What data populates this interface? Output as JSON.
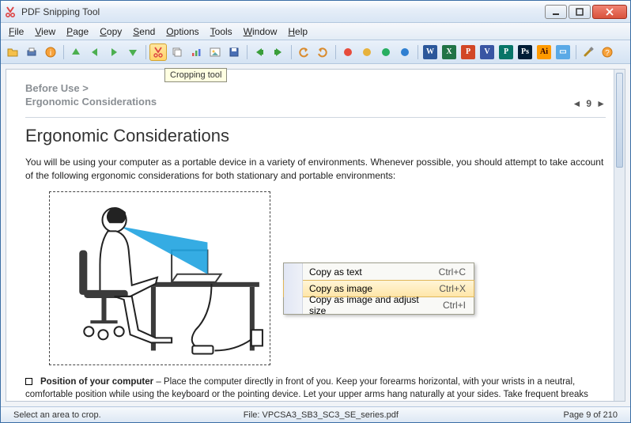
{
  "title": "PDF Snipping Tool",
  "menu": [
    "File",
    "View",
    "Page",
    "Copy",
    "Send",
    "Options",
    "Tools",
    "Window",
    "Help"
  ],
  "tooltip": "Cropping tool",
  "breadcrumb_top": "Before Use >",
  "breadcrumb_sub": "Ergonomic Considerations",
  "page_nav": {
    "left": "◄",
    "num": "9",
    "right": "►"
  },
  "doc": {
    "heading": "Ergonomic Considerations",
    "intro": "You will be using your computer as a portable device in a variety of environments. Whenever possible, you should attempt to take account of the following ergonomic considerations for both stationary and portable environments:",
    "bullet_title": "Position of your computer",
    "bullet_text": " – Place the computer directly in front of you. Keep your forearms horizontal, with your wrists in a neutral, comfortable position while using the keyboard or the pointing device. Let your upper arms hang naturally at your sides. Take frequent breaks while using your computer. Excessive use of the computer may strain eyes, muscles, or"
  },
  "context_menu": [
    {
      "label": "Copy as text",
      "shortcut": "Ctrl+C",
      "hl": false
    },
    {
      "label": "Copy as image",
      "shortcut": "Ctrl+X",
      "hl": true
    },
    {
      "label": "Copy as image and adjust size",
      "shortcut": "Ctrl+I",
      "hl": false
    }
  ],
  "status": {
    "left": "Select an area to crop.",
    "file": "File: VPCSA3_SB3_SC3_SE_series.pdf",
    "page": "Page 9 of 210"
  }
}
